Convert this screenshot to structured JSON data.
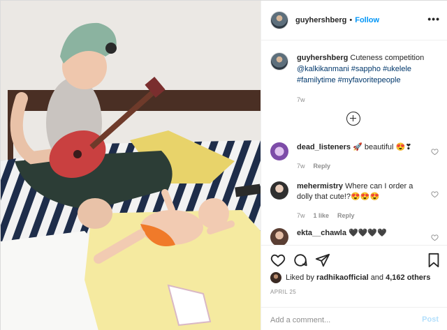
{
  "post": {
    "username": "guyhershberg",
    "separator": "•",
    "follow_label": "Follow",
    "more_label": "•••",
    "image_alt": "woman playing ukulele next to baby on bed"
  },
  "caption": {
    "username": "guyhershberg",
    "text": "Cuteness competition",
    "tags": "@kalkikanmani #sappho #ukelele #familytime #myfavoritepeople",
    "age": "7w"
  },
  "comments": [
    {
      "username": "dead_listeners",
      "text": "🚀 beautiful 😍❣",
      "age": "7w",
      "likes": "",
      "reply": "Reply",
      "avatar_color": "#7d4ca8"
    },
    {
      "username": "mehermistry",
      "text": "Where can I order a dolly that cute!?😍😍😍",
      "age": "7w",
      "likes": "1 like",
      "reply": "Reply",
      "avatar_color": "#3a3a3a"
    },
    {
      "username": "ekta__chawla",
      "text": "🖤🖤🖤🖤",
      "age": "",
      "likes": "",
      "reply": "",
      "avatar_color": "#8c6b58"
    }
  ],
  "actions": {
    "liked_by_prefix": "Liked by",
    "liked_by_user": "radhikaofficial",
    "and_label": "and",
    "likes_count": "4,162 others",
    "date": "APRIL 25",
    "add_comment_placeholder": "Add a comment...",
    "post_label": "Post"
  },
  "colors": {
    "link": "#00376b",
    "follow": "#0095f6",
    "muted": "#8e8e8e",
    "post_disabled": "#b2dffc"
  },
  "icons": [
    "heart-icon",
    "comment-icon",
    "share-icon",
    "bookmark-icon",
    "plus-circle-icon",
    "more-icon"
  ]
}
